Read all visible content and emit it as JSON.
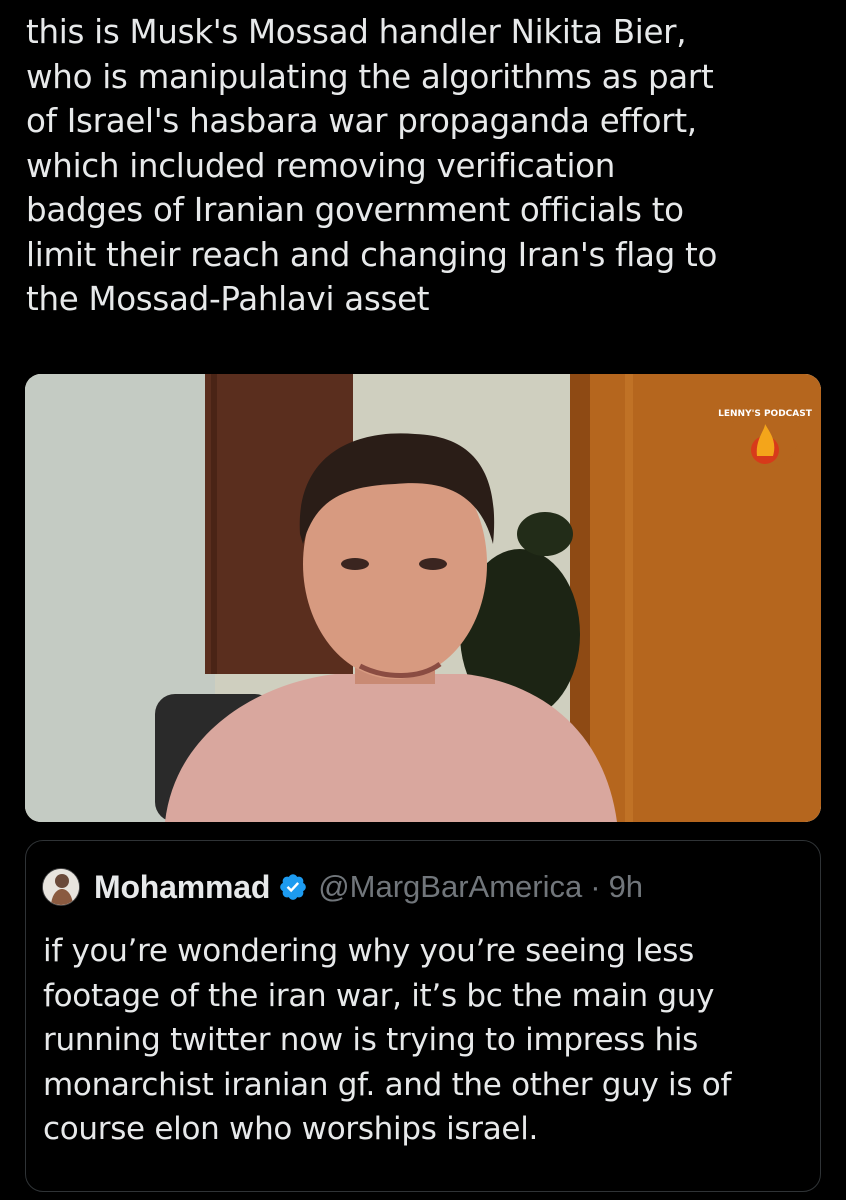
{
  "post": {
    "text_lines": [
      "this is Musk's Mossad handler Nikita Bier,",
      "who is manipulating the algorithms as part",
      "of Israel's hasbara war propaganda effort,",
      "which included removing verification",
      "badges of Iranian government officials to",
      "limit their reach and changing Iran's flag to",
      "the Mossad-Pahlavi asset"
    ]
  },
  "media": {
    "watermark_text": "LENNY'S PODCAST"
  },
  "quoted_post": {
    "display_name": "Mohammad",
    "handle": "@MargBarAmerica",
    "separator": "·",
    "time": "9h",
    "text_lines": [
      "if you’re wondering why you’re seeing less",
      "footage of the iran war, it’s bc the main guy",
      "running twitter now is trying to impress his",
      "monarchist iranian gf. and the other guy is of",
      "course elon who worships israel."
    ]
  },
  "colors": {
    "background": "#000000",
    "text": "#e7e9ea",
    "muted": "#71767b",
    "border": "#2f3336",
    "verified": "#1d9bf0"
  },
  "icons": [
    "verified-badge-icon",
    "avatar"
  ]
}
